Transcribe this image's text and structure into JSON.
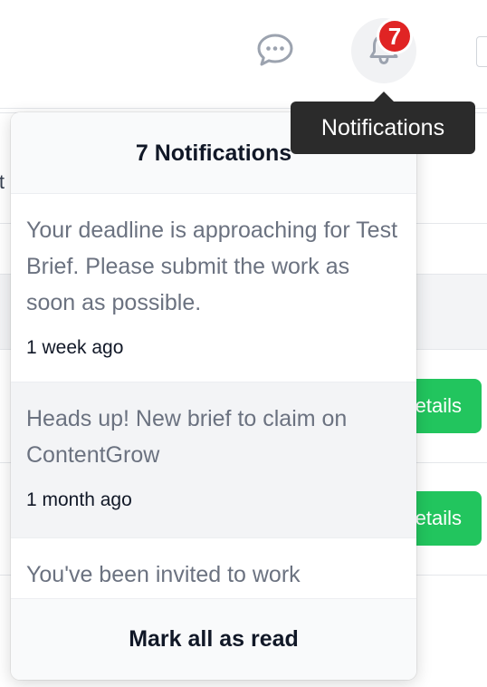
{
  "header": {
    "chat_icon": "chat-bubble-icon",
    "bell_icon": "bell-icon",
    "badge_count": "7",
    "tooltip": "Notifications"
  },
  "background": {
    "cutoff_text": "it",
    "details_button_label": "etails"
  },
  "notifications_panel": {
    "title": "7 Notifications",
    "items": [
      {
        "message": "Your deadline is approaching for Test Brief. Please submit the work as soon as possible.",
        "time": "1 week ago",
        "read": true
      },
      {
        "message": "Heads up! New brief to claim on ContentGrow",
        "time": "1 month ago",
        "read": false
      },
      {
        "message": "You've been invited to work"
      }
    ],
    "mark_all_read": "Mark all as read"
  },
  "colors": {
    "badge": "#e02424",
    "details_button": "#22c55e",
    "tooltip_bg": "#2b2b2b",
    "unread_bg": "#f3f4f6"
  }
}
